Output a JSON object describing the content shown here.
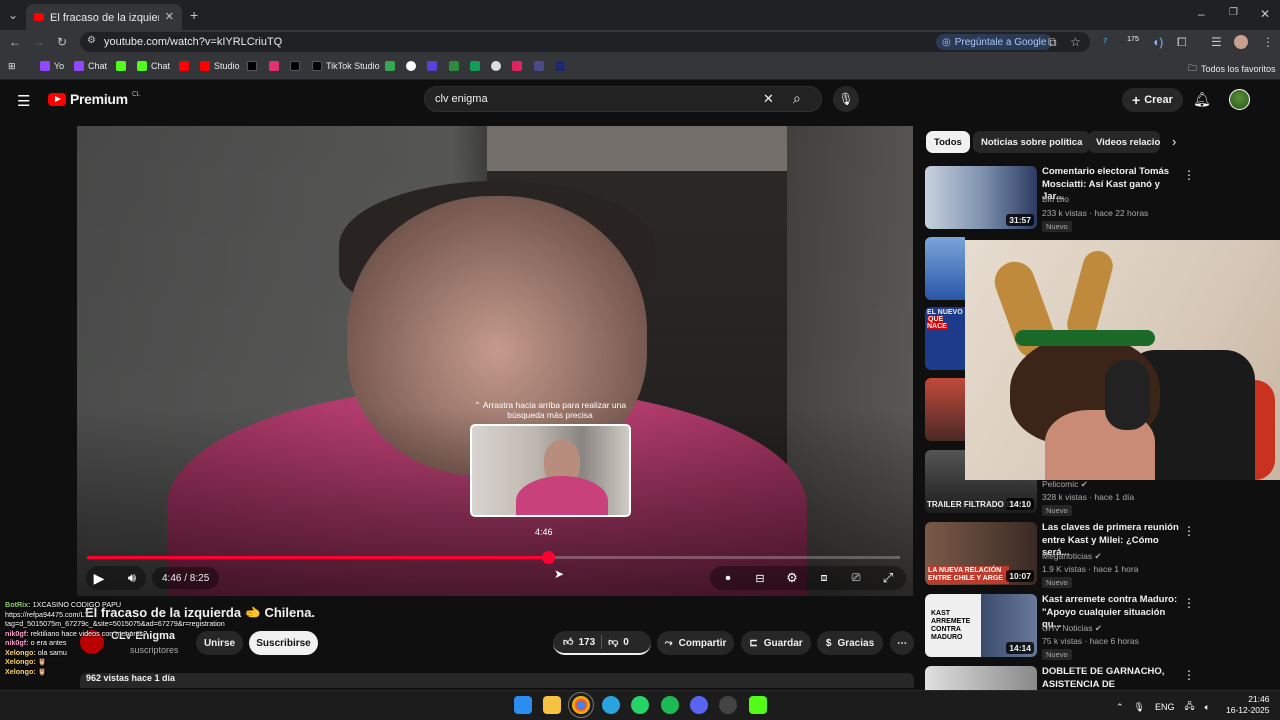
{
  "browser": {
    "tab_title": "El fracaso de la izquierda 🫲 Ch",
    "url": "youtube.com/watch?v=kIYRLCriuTQ",
    "ask_google": "Pregúntale a Google",
    "ext_badge": "175",
    "bookmarks": [
      "Yo",
      "Chat",
      "Chat",
      "Studio",
      "TikTok Studio"
    ],
    "all_favorites": "Todos los favoritos"
  },
  "youtube": {
    "logo_text": "Premium",
    "region": "CL",
    "search_value": "clv enigma",
    "create_label": "Crear"
  },
  "player": {
    "drag_tip": "Arrastra hacia arriba para realizar una búsqueda más precisa",
    "hover_time": "4:46",
    "time": "4:46 / 8:25",
    "progress": 0.567
  },
  "video": {
    "title": "El fracaso de la izquierda 🫲 Chilena.",
    "channel": "CLV Enigma",
    "subscribers": "suscriptores",
    "join_label": "Unirse",
    "subscribe_label": "Suscribirse",
    "likes": "173",
    "dislikes": "0",
    "share_label": "Compartir",
    "save_label": "Guardar",
    "thanks_label": "Gracias",
    "views_line": "962 vistas  hace 1 día"
  },
  "chips": [
    "Todos",
    "Noticias sobre política",
    "Videos relacio"
  ],
  "recommendations": [
    {
      "title": "Comentario electoral Tomás Mosciatti: Así Kast ganó y Jar...",
      "channel": "Bio Bio",
      "meta": "233 k vistas · hace 22 horas",
      "badge": "Nuevo",
      "duration": "31:57",
      "color": "#2b3b63"
    },
    {
      "title": "",
      "channel": "Pelicomic",
      "meta": "328 k vistas · hace 1 día",
      "badge": "Nuevo",
      "duration": "14:10",
      "thumb_text": "TRAILER FILTRADO EXPL",
      "color": "#1d1d1d"
    },
    {
      "title": "Las claves de primera reunión entre Kast y Milei: ¿Cómo será...",
      "channel": "Meganoticias",
      "meta": "1.9 K vistas · hace 1 hora",
      "badge": "Nuevo",
      "duration": "10:07",
      "thumb_text": "LA NUEVA RELACIÓN ENTRE CHILE Y ARGE",
      "color": "#5a3a2a"
    },
    {
      "title": "Kast arremete contra Maduro: \"Apoyo cualquier situación qu...",
      "channel": "CHV Noticias",
      "meta": "75 k vistas · hace 6 horas",
      "badge": "Nuevo",
      "duration": "14:14",
      "thumb_text": "KAST ARREMETE CONTRA MADURO",
      "color": "#e8e8e8"
    },
    {
      "title": "DOBLETE DE GARNACHO, ASISTENCIA DE BUONANOTT...",
      "channel": "",
      "meta": "",
      "badge": "",
      "duration": "",
      "color": "#d0d0d0"
    }
  ],
  "side_thumbs": [
    "EL NUEVO",
    "QUE NACE"
  ],
  "chat": [
    {
      "user": "BotRix:",
      "msg": "1XCASINO CODIGO PAPU https://refpa94475.com/L?tag=d_5015075m_67279c_&site=5015075&ad=67279&r=registration"
    },
    {
      "user": "nik0gf:",
      "msg": "rektiliano hace videos con menores?"
    },
    {
      "user": "nik0gf:",
      "msg": "o era antes"
    },
    {
      "user": "Xelongo:",
      "msg": "ola samu"
    },
    {
      "user": "Xelongo:",
      "msg": "🦉"
    },
    {
      "user": "Xelongo:",
      "msg": "🦉"
    }
  ],
  "taskbar": {
    "lang": "ENG",
    "time": "21:46",
    "date": "16-12-2025"
  },
  "colors": {
    "accent": "#ff0033",
    "youtube_red": "#ff0000",
    "bg": "#0f0f0f"
  }
}
